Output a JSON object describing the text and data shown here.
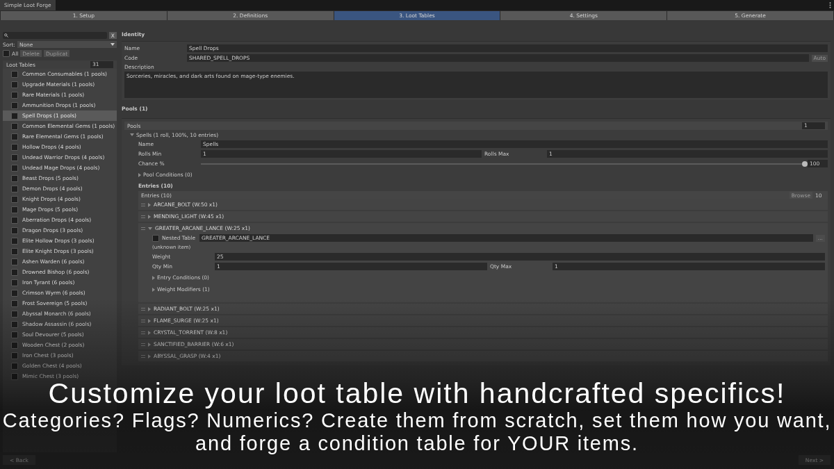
{
  "window": {
    "title": "Simple Loot Forge"
  },
  "tabs": [
    {
      "label": "1. Setup",
      "selected": false
    },
    {
      "label": "2. Definitions",
      "selected": false
    },
    {
      "label": "3. Loot Tables",
      "selected": true
    },
    {
      "label": "4. Settings",
      "selected": false
    },
    {
      "label": "5. Generate",
      "selected": false
    }
  ],
  "sidebar": {
    "clear_button": "X",
    "sort_label": "Sort:",
    "sort_value": "None",
    "select_all": {
      "label": "All",
      "checked": false
    },
    "buttons": [
      "Delete",
      "Duplicat"
    ],
    "list_title": "Loot Tables",
    "list_count": "31",
    "items": [
      {
        "label": "Common Consumables (1 pools)",
        "selected": false
      },
      {
        "label": "Upgrade Materials (1 pools)",
        "selected": false
      },
      {
        "label": "Rare Materials (1 pools)",
        "selected": false
      },
      {
        "label": "Ammunition Drops (1 pools)",
        "selected": false
      },
      {
        "label": "Spell Drops (1 pools)",
        "selected": true
      },
      {
        "label": "Common Elemental Gems (1 pools)",
        "selected": false
      },
      {
        "label": "Rare Elemental Gems (1 pools)",
        "selected": false
      },
      {
        "label": "Hollow Drops (4 pools)",
        "selected": false
      },
      {
        "label": "Undead Warrior Drops (4 pools)",
        "selected": false
      },
      {
        "label": "Undead Mage Drops (4 pools)",
        "selected": false
      },
      {
        "label": "Beast Drops (5 pools)",
        "selected": false
      },
      {
        "label": "Demon Drops (4 pools)",
        "selected": false
      },
      {
        "label": "Knight Drops (4 pools)",
        "selected": false
      },
      {
        "label": "Mage Drops (5 pools)",
        "selected": false
      },
      {
        "label": "Aberration Drops (4 pools)",
        "selected": false
      },
      {
        "label": "Dragon Drops (3 pools)",
        "selected": false
      },
      {
        "label": "Elite Hollow Drops (3 pools)",
        "selected": false
      },
      {
        "label": "Elite Knight Drops (3 pools)",
        "selected": false
      },
      {
        "label": "Ashen Warden (6 pools)",
        "selected": false
      },
      {
        "label": "Drowned Bishop (6 pools)",
        "selected": false
      },
      {
        "label": "Iron Tyrant (6 pools)",
        "selected": false
      },
      {
        "label": "Crimson Wyrm (6 pools)",
        "selected": false
      },
      {
        "label": "Frost Sovereign (5 pools)",
        "selected": false
      },
      {
        "label": "Abyssal Monarch (6 pools)",
        "selected": false
      },
      {
        "label": "Shadow Assassin (6 pools)",
        "selected": false
      },
      {
        "label": "Soul Devourer (5 pools)",
        "selected": false
      },
      {
        "label": "Wooden Chest (2 pools)",
        "selected": false
      },
      {
        "label": "Iron Chest (3 pools)",
        "selected": false
      },
      {
        "label": "Golden Chest (4 pools)",
        "selected": false
      },
      {
        "label": "Mimic Chest (3 pools)",
        "selected": false
      }
    ],
    "back_button": "< Back"
  },
  "identity": {
    "title": "Identity",
    "name_label": "Name",
    "name_value": "Spell Drops",
    "code_label": "Code",
    "code_value": "SHARED_SPELL_DROPS",
    "auto_button": "Auto",
    "description_label": "Description",
    "description_value": "Sorceries, miracles, and dark arts found on mage-type enemies."
  },
  "pools": {
    "title": "Pools (1)",
    "list_title": "Pools",
    "count": "1",
    "pool": {
      "title": "Spells (1 roll, 100%, 10 entries)",
      "expanded": true,
      "name_label": "Name",
      "name_value": "Spells",
      "rolls_min_label": "Rolls Min",
      "rolls_min_value": "1",
      "rolls_max_label": "Rolls Max",
      "rolls_max_value": "1",
      "chance_label": "Chance %",
      "chance": {
        "level": 1.0
      },
      "chance_value": "100",
      "conditions": {
        "label": "Pool Conditions (0)",
        "expanded": false
      },
      "entries_title": "Entries (10)",
      "entries_list_title": "Entries (10)",
      "browse_button": "Browse",
      "entries_count": "10",
      "entries": [
        {
          "label": "ARCANE_BOLT (W:50 x1)",
          "expanded": false
        },
        {
          "label": "MENDING_LIGHT (W:45 x1)",
          "expanded": false
        },
        {
          "label": "GREATER_ARCANE_LANCE (W:25 x1)",
          "expanded": true,
          "details": {
            "nested_label": "Nested Table",
            "nested_checked": false,
            "item_value": "GREATER_ARCANE_LANCE",
            "pick_button": "...",
            "note": "(unknown item)",
            "weight_label": "Weight",
            "weight_value": "25",
            "qty_min_label": "Qty Min",
            "qty_min_value": "1",
            "qty_max_label": "Qty Max",
            "qty_max_value": "1",
            "foldouts": [
              {
                "label": "Entry Conditions (0)",
                "expanded": false
              },
              {
                "label": "Weight Modifiers (1)",
                "expanded": false
              }
            ]
          }
        },
        {
          "label": "RADIANT_BOLT (W:25 x1)",
          "expanded": false
        },
        {
          "label": "FLAME_SURGE (W:25 x1)",
          "expanded": false
        },
        {
          "label": "CRYSTAL_TORRENT (W:8 x1)",
          "expanded": false
        },
        {
          "label": "SANCTIFIED_BARRIER (W:6 x1)",
          "expanded": false
        },
        {
          "label": "ABYSSAL_GRASP (W:4 x1)",
          "expanded": false
        }
      ]
    }
  },
  "next_button": "Next >",
  "caption": {
    "headline": "Customize your loot table with handcrafted specifics!",
    "subtitle": "Categories? Flags? Numerics? Create them from scratch, set them how you want, and forge a condition table for YOUR items."
  }
}
